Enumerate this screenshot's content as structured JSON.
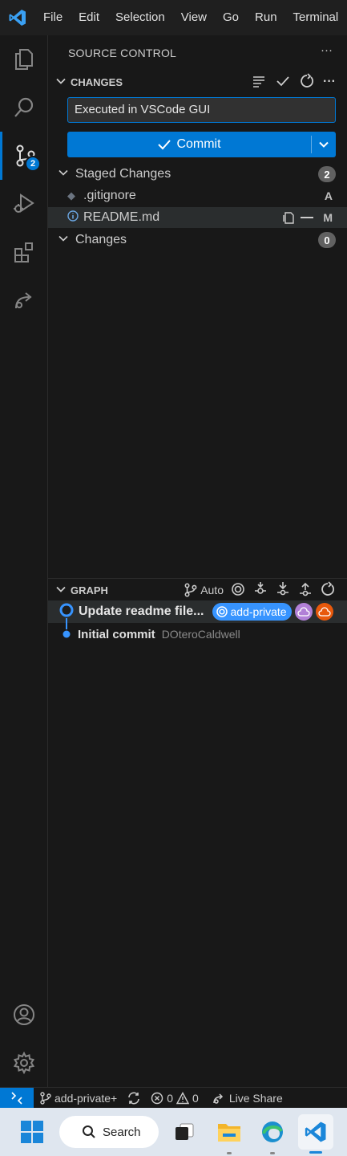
{
  "menu": [
    "File",
    "Edit",
    "Selection",
    "View",
    "Go",
    "Run",
    "Terminal"
  ],
  "activity": {
    "scm_badge": "2"
  },
  "sidebar": {
    "title": "SOURCE CONTROL",
    "changes_header": "CHANGES",
    "commit_message": "Executed in VSCode GUI",
    "commit_label": "Commit",
    "staged_label": "Staged Changes",
    "staged_count": "2",
    "files": [
      {
        "name": ".gitignore",
        "status": "A"
      },
      {
        "name": "README.md",
        "status": "M"
      }
    ],
    "changes_label": "Changes",
    "changes_count": "0"
  },
  "graph": {
    "header": "GRAPH",
    "auto_label": "Auto",
    "commits": [
      {
        "message": "Update readme file...",
        "branch": "add-private"
      },
      {
        "message": "Initial commit",
        "author": "DOteroCaldwell"
      }
    ]
  },
  "statusbar": {
    "branch": "add-private+",
    "errors": "0",
    "warnings": "0",
    "live_share": "Live Share"
  },
  "taskbar": {
    "search_label": "Search"
  },
  "colors": {
    "accent": "#0078d4",
    "branch_pill": "#3794ff",
    "purple": "#b180d7",
    "orange": "#e8590c"
  }
}
